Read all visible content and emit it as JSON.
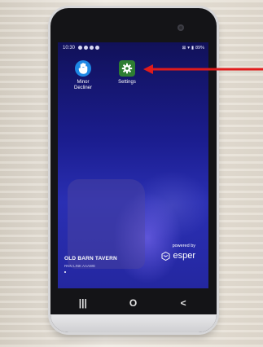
{
  "status_bar": {
    "time": "10:30",
    "battery": "89%"
  },
  "apps": [
    {
      "label_line1": "Minor",
      "label_line2": "Decliner",
      "icon": "hand-icon",
      "color": "#1e88e5"
    },
    {
      "label_line1": "Settings",
      "label_line2": "",
      "icon": "gear-icon",
      "color": "#2e7d32"
    }
  ],
  "venue": {
    "name": "OLD BARN TAVERN",
    "sub": "RNN LINK AAAWE"
  },
  "branding": {
    "powered_by": "powered by",
    "name": "esper"
  },
  "navbar": {
    "recents": "|||",
    "home": "O",
    "back": "<"
  },
  "annotation": {
    "color": "#e01b1b"
  }
}
